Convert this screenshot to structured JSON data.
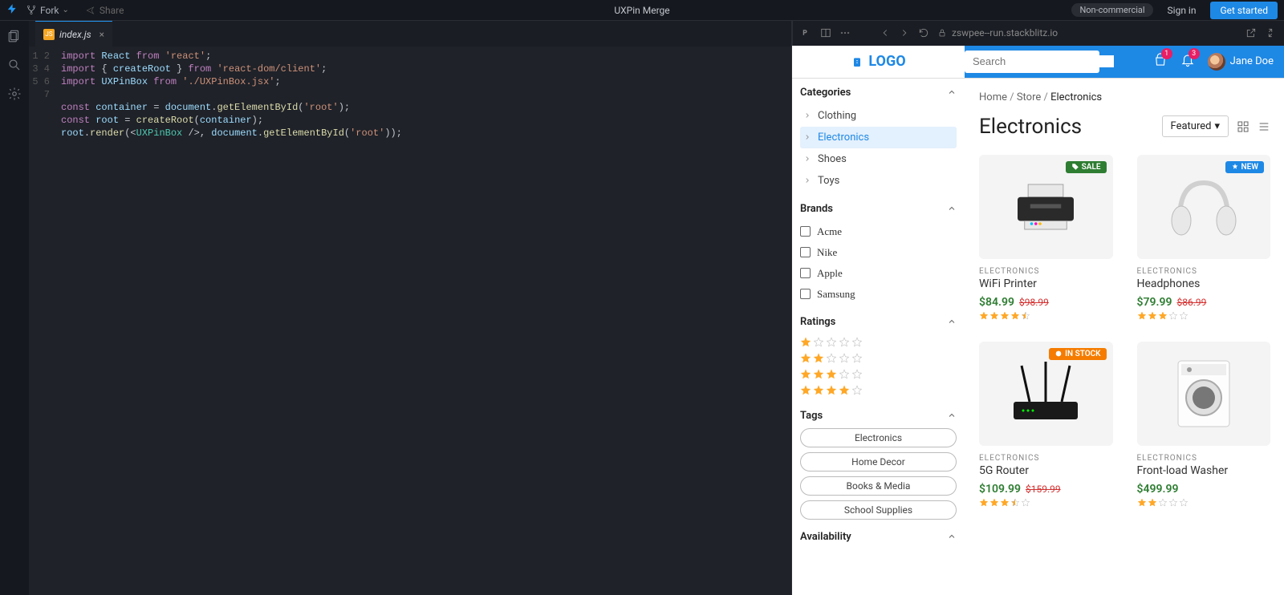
{
  "topbar": {
    "fork": "Fork",
    "share": "Share",
    "title": "UXPin Merge",
    "badge": "Non-commercial",
    "signin": "Sign in",
    "getstarted": "Get started"
  },
  "tab": {
    "filename": "index.js"
  },
  "code": {
    "lines": [
      "import React from 'react';",
      "import { createRoot } from 'react-dom/client';",
      "import UXPinBox from './UXPinBox.jsx';",
      "",
      "const container = document.getElementById('root');",
      "const root = createRoot(container);",
      "root.render(<UXPinBox />, document.getElementById('root'));"
    ]
  },
  "url": "zswpee--run.stackblitz.io",
  "shop": {
    "logo": "LOGO",
    "searchPlaceholder": "Search",
    "cartCount": "1",
    "notifCount": "3",
    "userName": "Jane Doe"
  },
  "sidebar": {
    "categoriesTitle": "Categories",
    "categories": [
      "Clothing",
      "Electronics",
      "Shoes",
      "Toys"
    ],
    "brandsTitle": "Brands",
    "brands": [
      "Acme",
      "Nike",
      "Apple",
      "Samsung"
    ],
    "ratingsTitle": "Ratings",
    "tagsTitle": "Tags",
    "tags": [
      "Electronics",
      "Home Decor",
      "Books & Media",
      "School Supplies"
    ],
    "availabilityTitle": "Availability"
  },
  "breadcrumbs": {
    "home": "Home",
    "store": "Store",
    "current": "Electronics"
  },
  "page": {
    "heading": "Electronics",
    "sort": "Featured"
  },
  "products": [
    {
      "badge": "SALE",
      "cat": "ELECTRONICS",
      "name": "WiFi Printer",
      "price": "$84.99",
      "old": "$98.99",
      "rating": 4.5
    },
    {
      "badge": "NEW",
      "cat": "ELECTRONICS",
      "name": "Headphones",
      "price": "$79.99",
      "old": "$86.99",
      "rating": 3
    },
    {
      "badge": "IN STOCK",
      "cat": "ELECTRONICS",
      "name": "5G Router",
      "price": "$109.99",
      "old": "$159.99",
      "rating": 3.5
    },
    {
      "badge": "",
      "cat": "ELECTRONICS",
      "name": "Front-load Washer",
      "price": "$499.99",
      "old": "",
      "rating": 2
    }
  ]
}
